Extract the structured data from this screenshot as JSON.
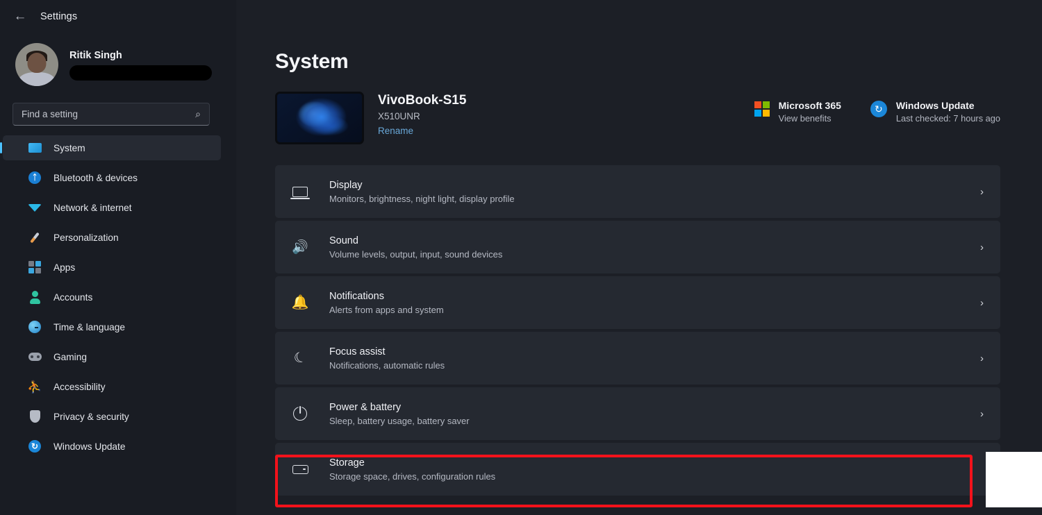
{
  "window": {
    "app_title": "Settings",
    "back_icon": "back-arrow-icon"
  },
  "profile": {
    "name": "Ritik Singh",
    "email_redacted": ""
  },
  "search": {
    "placeholder": "Find a setting",
    "value": "",
    "icon": "search-icon"
  },
  "sidebar": {
    "items": [
      {
        "label": "System",
        "icon": "system-icon",
        "selected": true
      },
      {
        "label": "Bluetooth & devices",
        "icon": "bluetooth-icon",
        "selected": false
      },
      {
        "label": "Network & internet",
        "icon": "wifi-icon",
        "selected": false
      },
      {
        "label": "Personalization",
        "icon": "paintbrush-icon",
        "selected": false
      },
      {
        "label": "Apps",
        "icon": "apps-grid-icon",
        "selected": false
      },
      {
        "label": "Accounts",
        "icon": "person-icon",
        "selected": false
      },
      {
        "label": "Time & language",
        "icon": "clock-icon",
        "selected": false
      },
      {
        "label": "Gaming",
        "icon": "gamepad-icon",
        "selected": false
      },
      {
        "label": "Accessibility",
        "icon": "accessibility-icon",
        "selected": false
      },
      {
        "label": "Privacy & security",
        "icon": "shield-icon",
        "selected": false
      },
      {
        "label": "Windows Update",
        "icon": "refresh-icon",
        "selected": false
      }
    ]
  },
  "main": {
    "page_title": "System",
    "device": {
      "name": "VivoBook-S15",
      "model": "X510UNR",
      "rename_label": "Rename",
      "thumbnail": "windows-bloom-wallpaper"
    },
    "widgets": [
      {
        "title": "Microsoft 365",
        "subtitle": "View benefits",
        "icon": "microsoft-logo-icon"
      },
      {
        "title": "Windows Update",
        "subtitle": "Last checked: 7 hours ago",
        "icon": "windows-update-refresh-icon"
      }
    ],
    "settings": [
      {
        "title": "Display",
        "subtitle": "Monitors, brightness, night light, display profile",
        "icon": "monitor-icon",
        "highlighted": false
      },
      {
        "title": "Sound",
        "subtitle": "Volume levels, output, input, sound devices",
        "icon": "speaker-icon",
        "highlighted": false
      },
      {
        "title": "Notifications",
        "subtitle": "Alerts from apps and system",
        "icon": "bell-icon",
        "highlighted": false
      },
      {
        "title": "Focus assist",
        "subtitle": "Notifications, automatic rules",
        "icon": "moon-icon",
        "highlighted": false
      },
      {
        "title": "Power & battery",
        "subtitle": "Sleep, battery usage, battery saver",
        "icon": "power-icon",
        "highlighted": false
      },
      {
        "title": "Storage",
        "subtitle": "Storage space, drives, configuration rules",
        "icon": "drive-icon",
        "highlighted": true
      }
    ],
    "chevron": "›"
  },
  "colors": {
    "accent": "#4cc2ff",
    "highlight": "#f3121b",
    "sidebar_bg": "#191c23",
    "main_bg": "#1c1f26",
    "row_bg": "#252931",
    "link": "#69a8d8"
  }
}
